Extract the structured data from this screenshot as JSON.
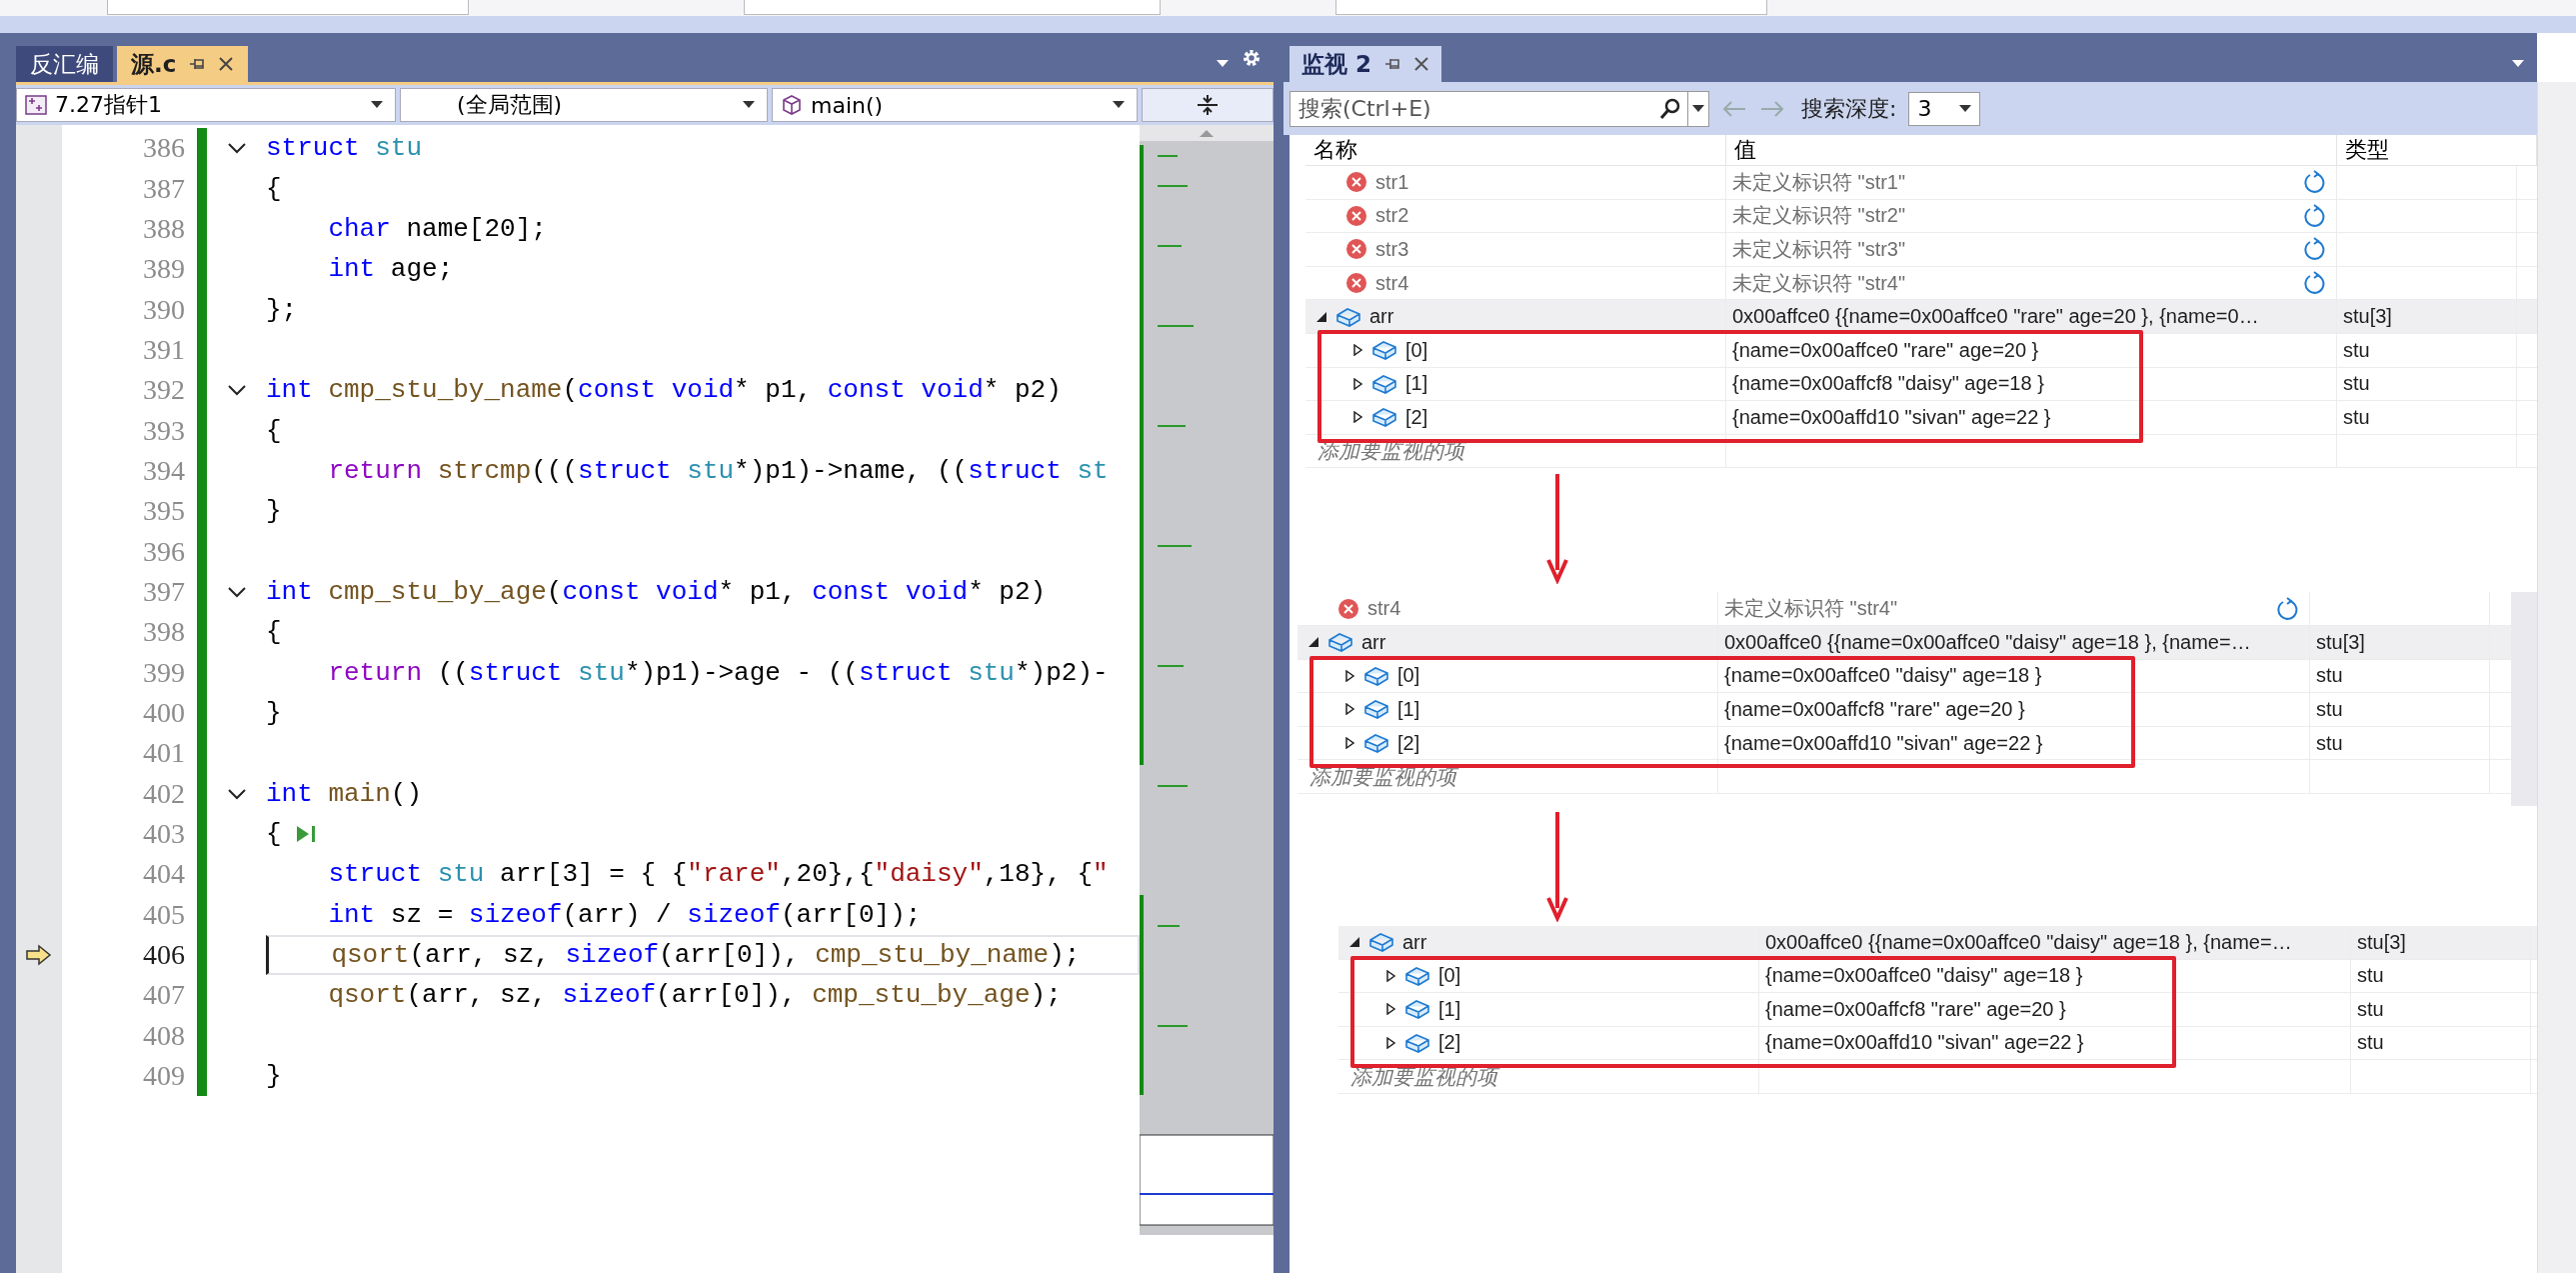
{
  "editor": {
    "tabs": [
      {
        "label": "反汇编",
        "selected": false
      },
      {
        "label": "源.c",
        "selected": true
      }
    ],
    "dropdowns": [
      {
        "kind": "project",
        "value": "7.27指针1"
      },
      {
        "kind": "scope",
        "value": "(全局范围)"
      },
      {
        "kind": "function",
        "value": "main()"
      }
    ],
    "lines": [
      {
        "number": "386",
        "kind": "foldable",
        "tokens": [
          {
            "kind": "kw",
            "text": "struct"
          },
          {
            "kind": "type",
            "text": " stu"
          }
        ]
      },
      {
        "number": "387",
        "kind": "plain",
        "tokens": [
          {
            "kind": "p",
            "text": "{"
          }
        ]
      },
      {
        "number": "388",
        "kind": "plain",
        "tokens": [
          {
            "kind": "kw",
            "text": "    char"
          },
          {
            "kind": "p",
            "text": " name[20];"
          }
        ]
      },
      {
        "number": "389",
        "kind": "plain",
        "tokens": [
          {
            "kind": "kw",
            "text": "    int"
          },
          {
            "kind": "p",
            "text": " age;"
          }
        ]
      },
      {
        "number": "390",
        "kind": "plain",
        "tokens": [
          {
            "kind": "p",
            "text": "};"
          }
        ]
      },
      {
        "number": "391",
        "kind": "plain"
      },
      {
        "number": "392",
        "kind": "foldable",
        "tokens": [
          {
            "kind": "kw",
            "text": "int"
          },
          {
            "kind": "fn",
            "text": " cmp_stu_by_name"
          },
          {
            "kind": "p",
            "text": "("
          },
          {
            "kind": "kw",
            "text": "const"
          },
          {
            "kind": "kw",
            "text": " void"
          },
          {
            "kind": "p",
            "text": "* p1, "
          },
          {
            "kind": "kw",
            "text": "const"
          },
          {
            "kind": "kw",
            "text": " void"
          },
          {
            "kind": "p",
            "text": "* p2)"
          }
        ]
      },
      {
        "number": "393",
        "kind": "plain",
        "tokens": [
          {
            "kind": "p",
            "text": "{"
          }
        ]
      },
      {
        "number": "394",
        "kind": "plain",
        "tokens": [
          {
            "kind": "ctl",
            "text": "    return"
          },
          {
            "kind": "fn",
            "text": " strcmp"
          },
          {
            "kind": "p",
            "text": "((("
          },
          {
            "kind": "kw",
            "text": "struct"
          },
          {
            "kind": "type",
            "text": " stu"
          },
          {
            "kind": "p",
            "text": "*)p1)->name, (("
          },
          {
            "kind": "kw",
            "text": "struct"
          },
          {
            "kind": "type",
            "text": " st"
          }
        ]
      },
      {
        "number": "395",
        "kind": "plain",
        "tokens": [
          {
            "kind": "p",
            "text": "}"
          }
        ]
      },
      {
        "number": "396",
        "kind": "plain"
      },
      {
        "number": "397",
        "kind": "foldable",
        "tokens": [
          {
            "kind": "kw",
            "text": "int"
          },
          {
            "kind": "fn",
            "text": " cmp_stu_by_age"
          },
          {
            "kind": "p",
            "text": "("
          },
          {
            "kind": "kw",
            "text": "const"
          },
          {
            "kind": "kw",
            "text": " void"
          },
          {
            "kind": "p",
            "text": "* p1, "
          },
          {
            "kind": "kw",
            "text": "const"
          },
          {
            "kind": "kw",
            "text": " void"
          },
          {
            "kind": "p",
            "text": "* p2)"
          }
        ]
      },
      {
        "number": "398",
        "kind": "plain",
        "tokens": [
          {
            "kind": "p",
            "text": "{"
          }
        ]
      },
      {
        "number": "399",
        "kind": "plain",
        "tokens": [
          {
            "kind": "ctl",
            "text": "    return"
          },
          {
            "kind": "p",
            "text": " (("
          },
          {
            "kind": "kw",
            "text": "struct"
          },
          {
            "kind": "type",
            "text": " stu"
          },
          {
            "kind": "p",
            "text": "*)p1)->age - (("
          },
          {
            "kind": "kw",
            "text": "struct"
          },
          {
            "kind": "type",
            "text": " stu"
          },
          {
            "kind": "p",
            "text": "*)p2)-"
          }
        ]
      },
      {
        "number": "400",
        "kind": "plain",
        "tokens": [
          {
            "kind": "p",
            "text": "}"
          }
        ]
      },
      {
        "number": "401",
        "kind": "plain"
      },
      {
        "number": "402",
        "kind": "foldable",
        "tokens": [
          {
            "kind": "kw",
            "text": "int"
          },
          {
            "kind": "fn",
            "text": " main"
          },
          {
            "kind": "p",
            "text": "()"
          }
        ]
      },
      {
        "number": "403",
        "kind": "plain",
        "tokens": [
          {
            "kind": "p",
            "text": "{"
          },
          {
            "kind": "run_icon"
          }
        ]
      },
      {
        "number": "404",
        "kind": "plain",
        "tokens": [
          {
            "kind": "kw",
            "text": "    struct"
          },
          {
            "kind": "type",
            "text": " stu"
          },
          {
            "kind": "p",
            "text": " arr[3] = { {"
          },
          {
            "kind": "str",
            "text": "\"rare\""
          },
          {
            "kind": "p",
            "text": ",20},{"
          },
          {
            "kind": "str",
            "text": "\"daisy\""
          },
          {
            "kind": "p",
            "text": ",18}, {"
          },
          {
            "kind": "str",
            "text": "\""
          }
        ]
      },
      {
        "number": "405",
        "kind": "plain",
        "tokens": [
          {
            "kind": "kw",
            "text": "    int"
          },
          {
            "kind": "p",
            "text": " sz = "
          },
          {
            "kind": "kw",
            "text": "sizeof"
          },
          {
            "kind": "p",
            "text": "(arr) / "
          },
          {
            "kind": "kw",
            "text": "sizeof"
          },
          {
            "kind": "p",
            "text": "(arr[0]);"
          }
        ]
      },
      {
        "number": "406",
        "kind": "current",
        "tokens": [
          {
            "kind": "fn",
            "text": "    qsort"
          },
          {
            "kind": "p",
            "text": "(arr, sz, "
          },
          {
            "kind": "kw",
            "text": "sizeof"
          },
          {
            "kind": "p",
            "text": "(arr[0]), "
          },
          {
            "kind": "fn",
            "text": "cmp_stu_by_name"
          },
          {
            "kind": "p",
            "text": ");"
          }
        ]
      },
      {
        "number": "407",
        "kind": "plain",
        "tokens": [
          {
            "kind": "fn",
            "text": "    qsort"
          },
          {
            "kind": "p",
            "text": "(arr, sz, "
          },
          {
            "kind": "kw",
            "text": "sizeof"
          },
          {
            "kind": "p",
            "text": "(arr[0]), "
          },
          {
            "kind": "fn",
            "text": "cmp_stu_by_age"
          },
          {
            "kind": "p",
            "text": ");"
          }
        ]
      },
      {
        "number": "408",
        "kind": "plain"
      },
      {
        "number": "409",
        "kind": "plain",
        "tokens": [
          {
            "kind": "p",
            "text": "}"
          }
        ]
      }
    ]
  },
  "watch": {
    "tab": {
      "label": "监视 2",
      "selected": true
    },
    "search": {
      "placeholder": "搜索(Ctrl+E)"
    },
    "depth": {
      "label": "搜索深度:",
      "value": "3"
    },
    "columns": [
      "名称",
      "值",
      "类型"
    ],
    "rows": [
      {
        "kind": "error",
        "name": "str1",
        "value": "未定义标识符 \"str1\""
      },
      {
        "kind": "error",
        "name": "str2",
        "value": "未定义标识符 \"str2\""
      },
      {
        "kind": "error",
        "name": "str3",
        "value": "未定义标识符 \"str3\""
      },
      {
        "kind": "error",
        "name": "str4",
        "value": "未定义标识符 \"str4\""
      },
      {
        "kind": "object",
        "name": "arr",
        "value": "0x00affce0 {{name=0x00affce0 \"rare\" age=20 }, {name=0…",
        "type": "stu[3]",
        "expanded": true,
        "highlighted": true,
        "children": [
          {
            "kind": "object",
            "name": "[0]",
            "value": "{name=0x00affce0 \"rare\" age=20 }",
            "type": "stu",
            "expanded": false
          },
          {
            "kind": "object",
            "name": "[1]",
            "value": "{name=0x00affcf8 \"daisy\" age=18 }",
            "type": "stu",
            "expanded": false
          },
          {
            "kind": "object",
            "name": "[2]",
            "value": "{name=0x00affd10 \"sivan\" age=22 }",
            "type": "stu",
            "expanded": false
          }
        ]
      }
    ],
    "add_placeholder": "添加要监视的项"
  },
  "snapshots": [
    {
      "rows": [
        {
          "kind": "error",
          "name": "str4",
          "value": "未定义标识符 \"str4\""
        },
        {
          "kind": "object",
          "name": "arr",
          "value": "0x00affce0 {{name=0x00affce0 \"daisy\" age=18 }, {name=…",
          "type": "stu[3]",
          "expanded": true,
          "highlighted": true,
          "children": [
            {
              "kind": "object",
              "name": "[0]",
              "value": "{name=0x00affce0 \"daisy\" age=18 }",
              "type": "stu",
              "expanded": false
            },
            {
              "kind": "object",
              "name": "[1]",
              "value": "{name=0x00affcf8 \"rare\" age=20 }",
              "type": "stu",
              "expanded": false
            },
            {
              "kind": "object",
              "name": "[2]",
              "value": "{name=0x00affd10 \"sivan\" age=22 }",
              "type": "stu",
              "expanded": false
            }
          ]
        }
      ],
      "add_placeholder": "添加要监视的项"
    },
    {
      "rows": [
        {
          "kind": "object",
          "name": "arr",
          "value": "0x00affce0 {{name=0x00affce0 \"daisy\" age=18 }, {name=…",
          "type": "stu[3]",
          "expanded": true,
          "highlighted": true,
          "children": [
            {
              "kind": "object",
              "name": "[0]",
              "value": "{name=0x00affce0 \"daisy\" age=18 }",
              "type": "stu",
              "expanded": false
            },
            {
              "kind": "object",
              "name": "[1]",
              "value": "{name=0x00affcf8 \"rare\" age=20 }",
              "type": "stu",
              "expanded": false
            },
            {
              "kind": "object",
              "name": "[2]",
              "value": "{name=0x00affd10 \"sivan\" age=22 }",
              "type": "stu",
              "expanded": false
            }
          ]
        }
      ],
      "add_placeholder": "添加要监视的项"
    }
  ]
}
